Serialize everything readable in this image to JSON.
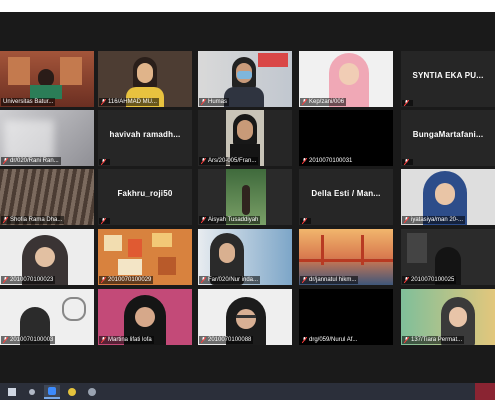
{
  "participants": [
    {
      "label": "Universitas Batur...",
      "muted": false,
      "video": "room",
      "active": true
    },
    {
      "label": "116/AHMAD MU...",
      "muted": true,
      "video": "person-yellow"
    },
    {
      "label": "Humas",
      "muted": true,
      "video": "person-mask"
    },
    {
      "label": "Kep/zani/006",
      "muted": true,
      "video": "person-hijab-pink"
    },
    {
      "label": "",
      "muted": true,
      "video": "name",
      "name": "SYNTIA EKA PU..."
    },
    {
      "label": "dr/020/Rani Ran...",
      "muted": true,
      "video": "blurry-light"
    },
    {
      "label": "",
      "muted": true,
      "video": "name",
      "name": "havivah ramadh..."
    },
    {
      "label": "Ars/20-005/Fran...",
      "muted": true,
      "video": "person-portrait"
    },
    {
      "label": "2010070100031",
      "muted": true,
      "video": "black"
    },
    {
      "label": "",
      "muted": true,
      "video": "name",
      "name": "BungaMartafani..."
    },
    {
      "label": "Shofia Rama Dha...",
      "muted": true,
      "video": "curtain"
    },
    {
      "label": "",
      "muted": true,
      "video": "name",
      "name": "Fakhru_roji50"
    },
    {
      "label": "Aisyah Tusaddiyah",
      "muted": true,
      "video": "outdoor"
    },
    {
      "label": "",
      "muted": true,
      "video": "name",
      "name": "Della Esti / Man..."
    },
    {
      "label": "iyatasiya/man 20-...",
      "muted": true,
      "video": "person-hijab-dark"
    },
    {
      "label": "2010070100023",
      "muted": true,
      "video": "person-hijab-light"
    },
    {
      "label": "2010070100029",
      "muted": true,
      "video": "decor"
    },
    {
      "label": "Far/020/Nur inda...",
      "muted": true,
      "video": "room-blue"
    },
    {
      "label": "dr/jannatul hikm...",
      "muted": true,
      "video": "bridge"
    },
    {
      "label": "2010070100025",
      "muted": true,
      "video": "dark-person"
    },
    {
      "label": "2010070100003",
      "muted": true,
      "video": "person-fan"
    },
    {
      "label": "Martina lifati lofa",
      "muted": true,
      "video": "person-hijab-pinkbg"
    },
    {
      "label": "2010070100088",
      "muted": true,
      "video": "person-glasses"
    },
    {
      "label": "drg/059/Nurul Af...",
      "muted": true,
      "video": "black"
    },
    {
      "label": "137/Tiara Permat...",
      "muted": true,
      "video": "person-teal"
    }
  ],
  "taskbar": {
    "items": [
      "start",
      "search",
      "zoom",
      "chrome",
      "settings"
    ]
  }
}
